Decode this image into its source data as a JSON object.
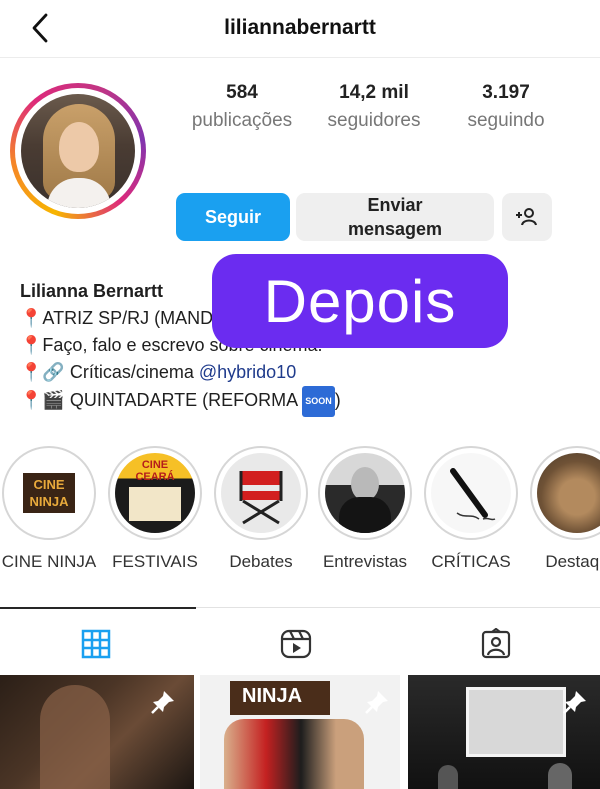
{
  "header": {
    "username": "liliannabernartt"
  },
  "stats": [
    {
      "value": "584",
      "label": "publicações"
    },
    {
      "value": "14,2 mil",
      "label": "seguidores"
    },
    {
      "value": "3.197",
      "label": "seguindo"
    }
  ],
  "actions": {
    "follow_label": "Seguir",
    "message_line1": "Enviar",
    "message_line2": "mensagem"
  },
  "bio": {
    "name": "Lilianna Bernartt",
    "line1": "ATRIZ SP/RJ (MAND",
    "line2": "Faço, falo e escrevo sobre cinema.",
    "line3_prefix": "🔗 Críticas/cinema ",
    "line3_link": "@hybrido10",
    "line4_prefix": "🎬 QUINTADARTE (REFORMA ",
    "line4_suffix": ")",
    "soon_badge": "SOON"
  },
  "overlay": {
    "label": "Depois"
  },
  "highlights": [
    {
      "label": "CINE NINJA",
      "cover_text": "CINE NINJA"
    },
    {
      "label": "FESTIVAIS",
      "cover_text": "CINE CEARÁ"
    },
    {
      "label": "Debates"
    },
    {
      "label": "Entrevistas"
    },
    {
      "label": "CRÍTICAS"
    },
    {
      "label": "Destaqu"
    }
  ],
  "tabs": [
    {
      "icon": "grid-icon",
      "active": true
    },
    {
      "icon": "reels-icon",
      "active": false
    },
    {
      "icon": "tagged-icon",
      "active": false
    }
  ],
  "posts": [
    {
      "icon": "pin-icon",
      "cover_text": ""
    },
    {
      "icon": "pin-icon",
      "cover_text": "NINJA"
    },
    {
      "icon": "pin-icon",
      "cover_text": ""
    }
  ],
  "colors": {
    "accent": "#1aa0f0",
    "overlay": "#6b2cf0"
  }
}
